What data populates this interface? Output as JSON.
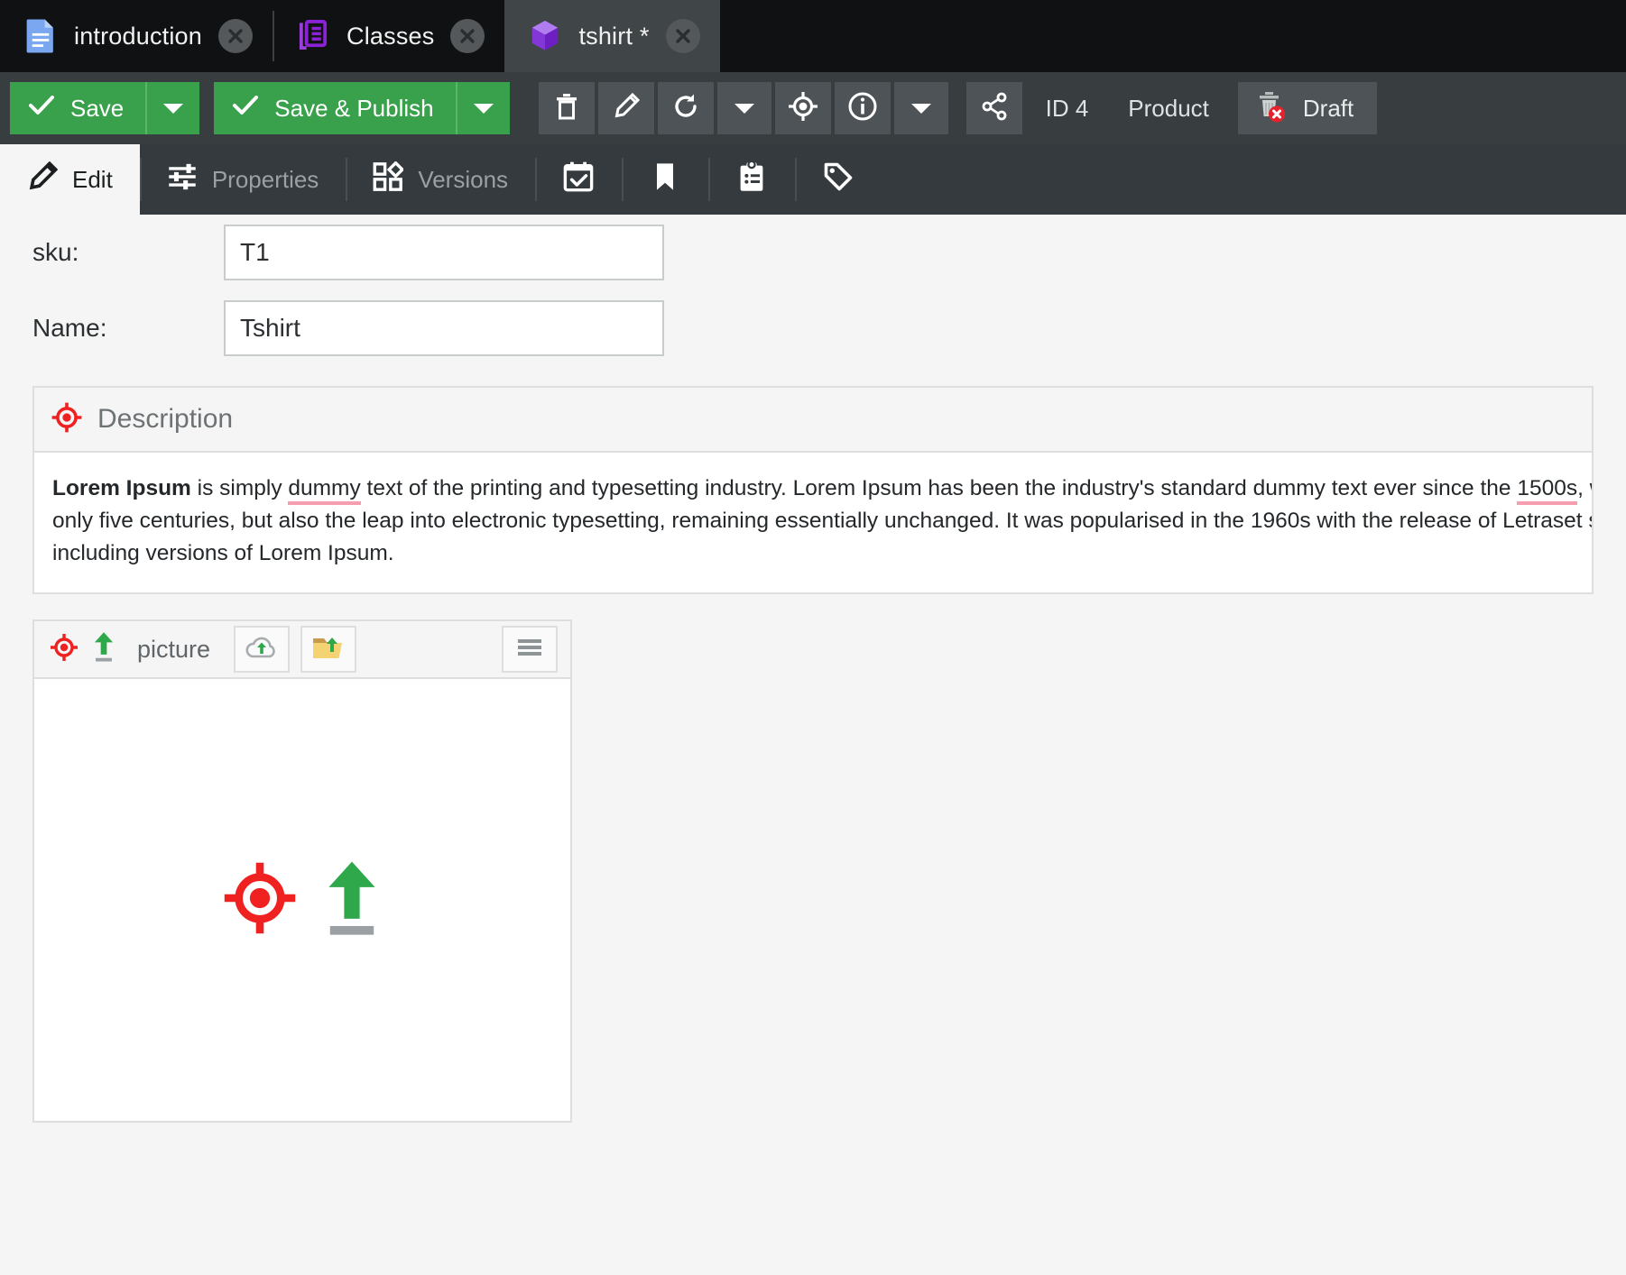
{
  "window": {
    "tabs": [
      {
        "label": "introduction",
        "icon": "google-doc-icon",
        "active": false,
        "close": "close-icon"
      },
      {
        "label": "Classes",
        "icon": "classes-icon",
        "active": false,
        "close": "close-icon"
      },
      {
        "label": "tshirt *",
        "icon": "object-cube-icon",
        "active": true,
        "close": "close-icon"
      }
    ]
  },
  "toolbar": {
    "save_label": "Save",
    "save_caret": "chevron-down-icon",
    "save_publish_label": "Save & Publish",
    "save_publish_caret": "chevron-down-icon",
    "delete_icon": "trash-icon",
    "rename_icon": "pencil-icon",
    "reload_icon": "reload-icon",
    "reload_caret": "chevron-down-icon",
    "target_icon": "target-icon",
    "info_icon": "info-icon",
    "info_caret": "chevron-down-icon",
    "share_icon": "share-icon",
    "id_label": "ID 4",
    "type_label": "Product",
    "status_icon": "trash-error-icon",
    "status_label": "Draft",
    "accent_green": "#39a04b",
    "toolbar_bg": "#383d40",
    "button_bg": "#4d5356"
  },
  "section_tabs": [
    {
      "label": "Edit",
      "icon": "pencil-icon",
      "active": true
    },
    {
      "label": "Properties",
      "icon": "sliders-icon",
      "active": false
    },
    {
      "label": "Versions",
      "icon": "versions-grid-icon",
      "active": false
    },
    {
      "label": "",
      "icon": "calendar-check-icon",
      "active": false
    },
    {
      "label": "",
      "icon": "bookmark-icon",
      "active": false
    },
    {
      "label": "",
      "icon": "clipboard-list-icon",
      "active": false
    },
    {
      "label": "",
      "icon": "tag-icon",
      "active": false
    }
  ],
  "form": {
    "sku": {
      "label": "sku:",
      "value": "T1",
      "placeholder": ""
    },
    "name": {
      "label": "Name:",
      "value": "Tshirt",
      "placeholder": ""
    }
  },
  "description": {
    "icon": "target-icon",
    "title": "Description",
    "text_lead": "Lorem Ipsum",
    "line1_a": " is simply ",
    "line1_spell1": "dummy",
    "line1_b": " text of the printing and typesetting industry. Lorem Ipsum has been the industry's standard dummy text ever since the ",
    "line1_spell2": "1500s",
    "line1_c": ", when an unknown printer took a galley of type and scrambled it to make a type specimen book. It has survived not",
    "line2": "only five centuries, but also the leap into electronic typesetting, remaining essentially unchanged. It was popularised in the 1960s with the release of Letraset sheets containing Lorem Ipsum passages, and more recently with desktop publishing software like Aldus PageMaker",
    "line3": "including versions of Lorem Ipsum."
  },
  "picture_widget": {
    "target_icon": "target-icon",
    "upload_icon": "upload-arrow-icon",
    "title": "picture",
    "cloud_upload_icon": "cloud-upload-icon",
    "folder_upload_icon": "folder-upload-icon",
    "menu_icon": "hamburger-menu-icon",
    "drop_target_icon": "target-icon",
    "drop_upload_icon": "upload-arrow-icon"
  },
  "colors": {
    "red": "#f02121",
    "green": "#2ea84a",
    "purple": "#8b3fd4",
    "spellcheck_underline": "#f79db0"
  }
}
